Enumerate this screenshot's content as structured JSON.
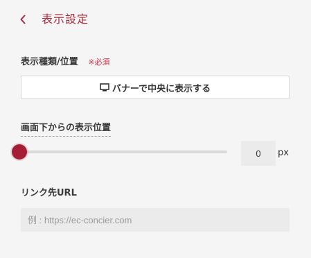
{
  "header": {
    "title": "表示設定",
    "back_icon": "chevron-left-icon"
  },
  "display_type": {
    "label": "表示種類/位置",
    "required": "※必須",
    "button_label": "バナーで中央に表示する",
    "button_icon": "monitor-icon"
  },
  "position": {
    "label": "画面下からの表示位置",
    "value": "0",
    "unit": "px",
    "slider_fraction": 0
  },
  "link": {
    "label": "リンク先URL",
    "value": "",
    "placeholder": "例 : https://ec-concier.com"
  },
  "colors": {
    "accent": "#a61e35",
    "title": "#a82a3c",
    "required": "#cc3344",
    "background": "#f5f5f5",
    "input_bg": "#ebebeb"
  }
}
